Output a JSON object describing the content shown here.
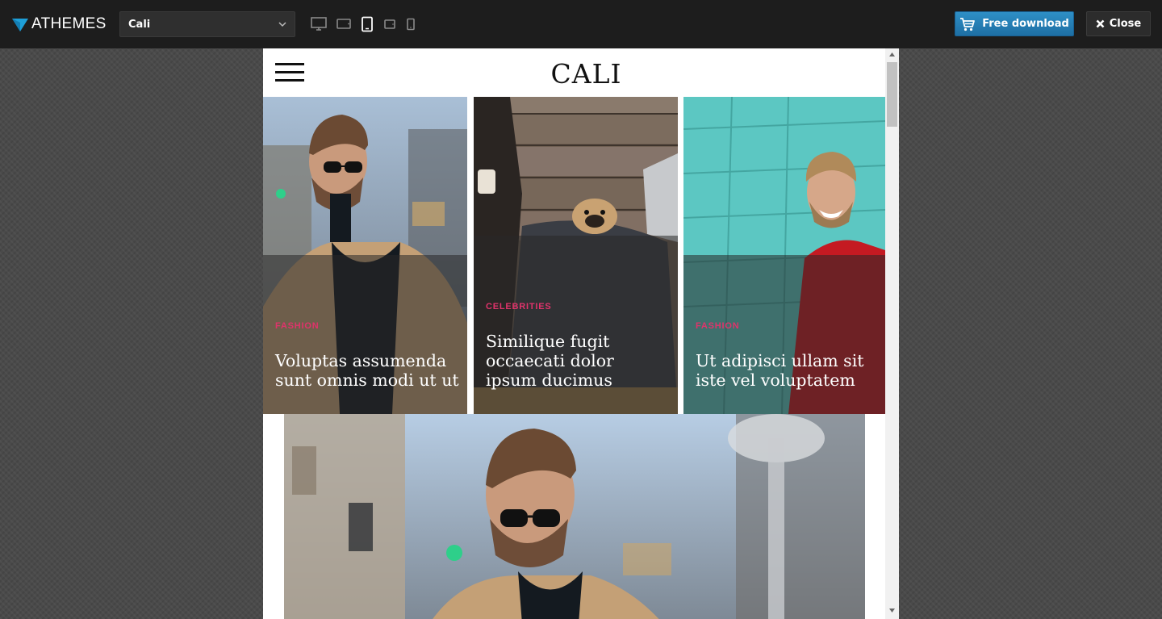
{
  "topbar": {
    "brand": "ATHEMES",
    "theme_select": "Cali",
    "devices": [
      "desktop-icon",
      "laptop-icon",
      "tablet-portrait-icon",
      "tablet-landscape-icon",
      "mobile-icon"
    ],
    "download_label": "Free download",
    "close_label": "Close",
    "download_color": "#2683bb"
  },
  "site": {
    "title": "CALI",
    "accent_color": "#e0336b",
    "posts": [
      {
        "category": "FASHION",
        "title": "Voluptas assumenda sunt omnis modi ut ut"
      },
      {
        "category": "CELEBRITIES",
        "title": "Similique fugit occaecati dolor ipsum ducimus"
      },
      {
        "category": "FASHION",
        "title": "Ut adipisci ullam sit iste vel voluptatem"
      }
    ]
  }
}
